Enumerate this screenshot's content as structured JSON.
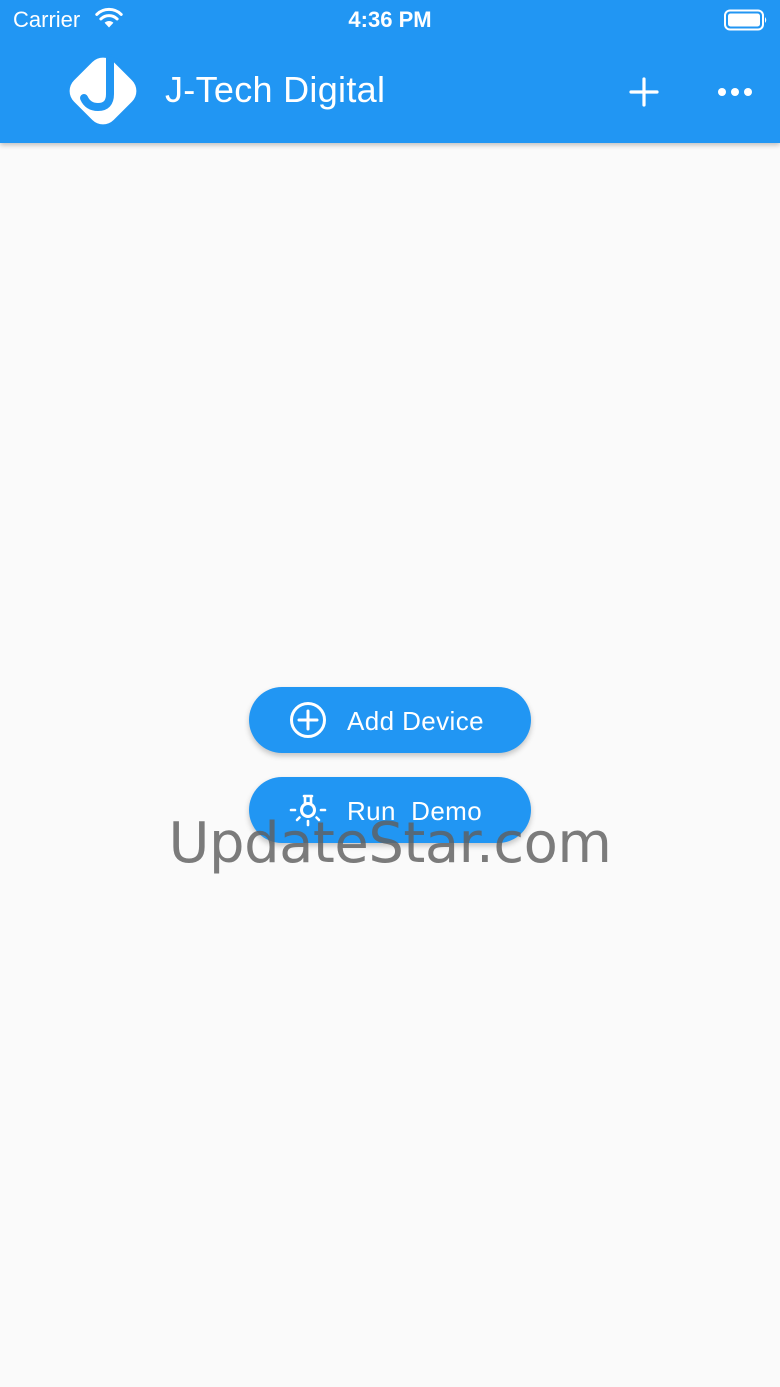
{
  "status_bar": {
    "carrier": "Carrier",
    "time": "4:36 PM",
    "wifi_icon": "wifi-icon",
    "battery_icon": "battery-full-icon"
  },
  "app_bar": {
    "title": "J-Tech Digital",
    "logo_icon": "jtech-logo",
    "actions": [
      {
        "icon": "plus-icon"
      },
      {
        "icon": "more-horizontal-icon"
      }
    ],
    "color": "#2196f3"
  },
  "main": {
    "buttons": [
      {
        "label": "Add Device",
        "icon": "add-circle-icon"
      },
      {
        "label": "Run  Demo",
        "icon": "light-bulb-icon"
      }
    ]
  },
  "watermark": {
    "text": "UpdateStar.com"
  },
  "colors": {
    "primary": "#2196f3",
    "background": "#fafafa",
    "on_primary": "#ffffff"
  }
}
